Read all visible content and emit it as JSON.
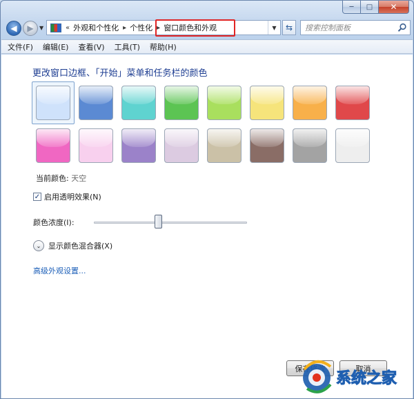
{
  "caption": {
    "minimize": "─",
    "maximize": "□",
    "close": "✕"
  },
  "address": {
    "crumbs": [
      "外观和个性化",
      "个性化",
      "窗口颜色和外观"
    ],
    "separators": [
      "«",
      "▸",
      "▸"
    ]
  },
  "search": {
    "placeholder": "搜索控制面板"
  },
  "menu": [
    "文件(F)",
    "编辑(E)",
    "查看(V)",
    "工具(T)",
    "帮助(H)"
  ],
  "main": {
    "heading": "更改窗口边框、「开始」菜单和任务栏的颜色",
    "swatches": [
      {
        "color": "#cfe2fb",
        "selected": true
      },
      {
        "color": "#5b8ad3"
      },
      {
        "color": "#5fd3d0"
      },
      {
        "color": "#5cc453"
      },
      {
        "color": "#a9df5e"
      },
      {
        "color": "#f6e47b"
      },
      {
        "color": "#f8b04a"
      },
      {
        "color": "#e0484a"
      },
      {
        "color": "#f067c2"
      },
      {
        "color": "#f8d0ee"
      },
      {
        "color": "#9b82c9"
      },
      {
        "color": "#dccbe1"
      },
      {
        "color": "#cbc1a7"
      },
      {
        "color": "#8a6d66"
      },
      {
        "color": "#a3a3a3"
      },
      {
        "color": "#eeeeee"
      }
    ],
    "current_color_label": "当前颜色:",
    "current_color_value": "天空",
    "transparency_label": "启用透明效果(N)",
    "transparency_checked": "✓",
    "intensity_label": "颜色浓度(I):",
    "intensity_value": 0.42,
    "mixer_label": "显示颜色混合器(X)",
    "mixer_icon": "⌄",
    "advanced_link": "高级外观设置..."
  },
  "footer": {
    "save_label": "保存修改",
    "cancel_label": "取消"
  },
  "watermark_text": "系统之家"
}
